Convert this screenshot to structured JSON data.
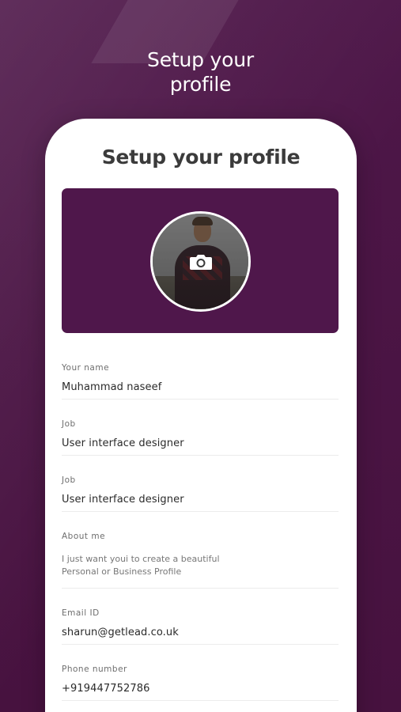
{
  "hero": {
    "title_line1": "Setup your",
    "title_line2": "profile"
  },
  "screen": {
    "title": "Setup your profile"
  },
  "cover": {
    "color": "#4f174b",
    "avatar_icon": "camera-icon"
  },
  "fields": {
    "name": {
      "label": "Your name",
      "value": "Muhammad naseef"
    },
    "job1": {
      "label": "Job",
      "value": "User interface designer"
    },
    "job2": {
      "label": "Job",
      "value": "User interface designer"
    },
    "about": {
      "label": "About me",
      "value": "I just want youi to create a beautiful Personal or Business Profile"
    },
    "email": {
      "label": "Email ID",
      "value": "sharun@getlead.co.uk"
    },
    "phone": {
      "label": "Phone number",
      "value": "+919447752786"
    }
  },
  "colors": {
    "background": "#4a1447",
    "accent": "#4f174b",
    "card": "#ffffff"
  }
}
